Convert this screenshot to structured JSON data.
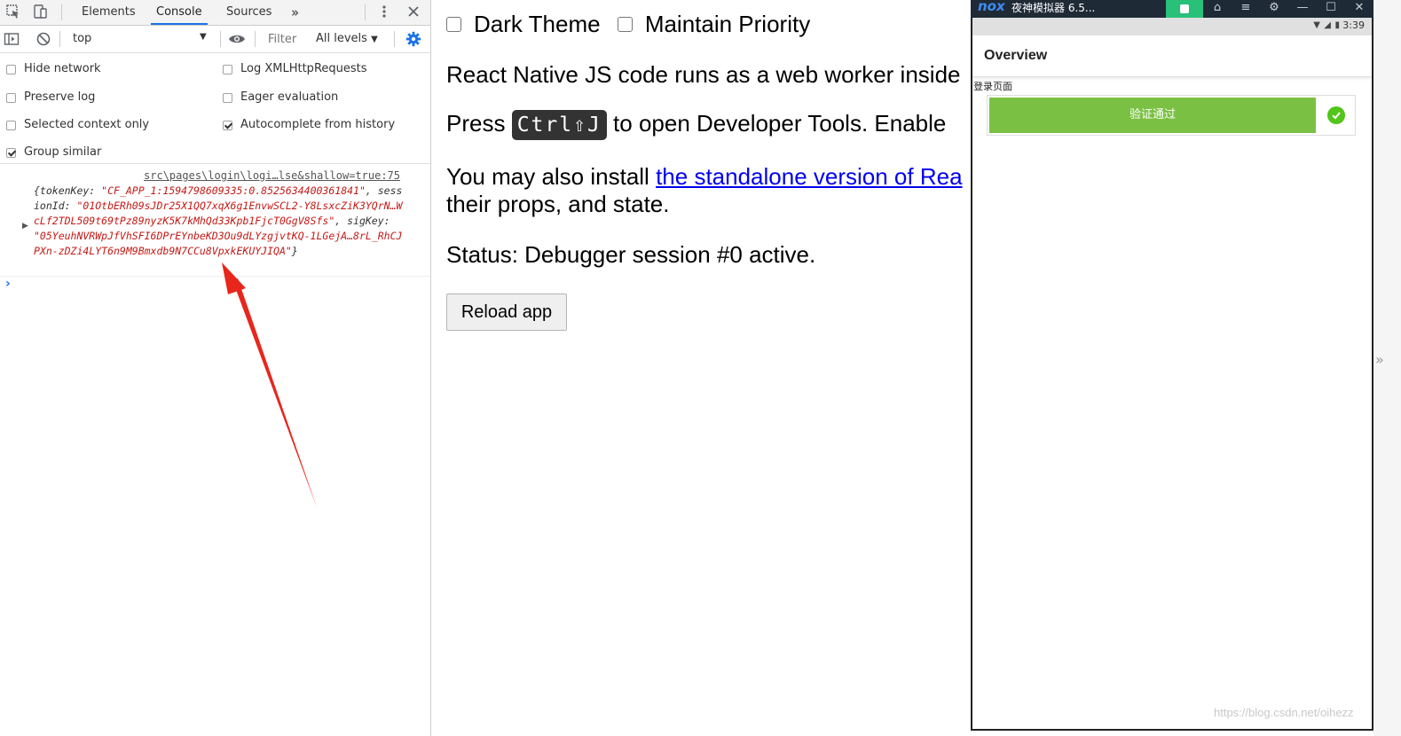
{
  "devtools": {
    "tabs": [
      "Elements",
      "Console",
      "Sources"
    ],
    "more_tabs_glyph": "»",
    "toolbar": {
      "context": "top",
      "filter_placeholder": "Filter",
      "levels": "All levels"
    },
    "settings": {
      "hide_network": "Hide network",
      "log_xhr": "Log XMLHttpRequests",
      "preserve_log": "Preserve log",
      "eager_eval": "Eager evaluation",
      "selected_context": "Selected context only",
      "autocomplete": "Autocomplete from history",
      "group_similar": "Group similar"
    },
    "console": {
      "source": "src\\pages\\login\\logi…lse&shallow=true:75",
      "p1": "{tokenKey: ",
      "v1": "\"CF_APP_1:1594798609335:0.8525634400361841\"",
      "p2": ", sessionId: ",
      "v2": "\"01OtbERh09sJDr25X1QQ7xqX6g1EnvwSCL2-Y8LsxcZiK3YQrN…WcLf2TDL509t69tPz89nyzK5K7kMhQd33Kpb1FjcT0GgV8Sfs\"",
      "p3": ", sigKey: ",
      "v3": "\"05YeuhNVRWpJfVhSFI6DPrEYnbeKD3Ou9dLYzgjvtKQ-1LGejA…8rL_RhCJPXn-zDZi4LYT6n9M9Bmxdb9N7CCu8VpxkEKUYJIQA\"",
      "p4": "}",
      "prompt": "›"
    }
  },
  "debugger_page": {
    "dark_theme": "Dark Theme",
    "maintain_priority": "Maintain Priority",
    "line1": "React Native JS code runs as a web worker inside",
    "press": "Press",
    "shortcut": "Ctrl⇧J",
    "line2_rest": "to open Developer Tools. Enable",
    "line3_start": "You may also install",
    "line3_link": "the standalone version of Rea",
    "line3_end": "their props, and state.",
    "status": "Status: Debugger session #0 active.",
    "reload": "Reload app"
  },
  "emulator": {
    "logo": "nox",
    "title": "夜神模拟器 6.5...",
    "time": "3:39",
    "appbar_title": "Overview",
    "page_label": "登录页面",
    "verify_text": "验证通过",
    "accent": "#7ac143"
  },
  "watermark": "https://blog.csdn.net/oihezz"
}
